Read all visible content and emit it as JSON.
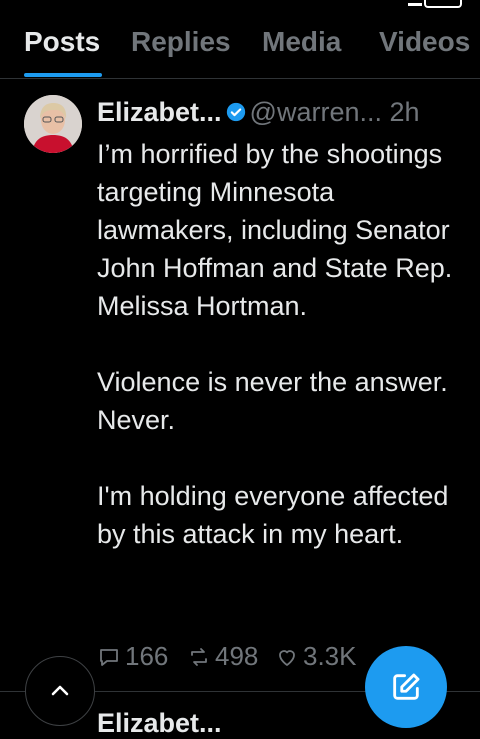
{
  "tabs": [
    "Posts",
    "Replies",
    "Media",
    "Videos"
  ],
  "post": {
    "display_name": "Elizabet...",
    "handle": "@warren...",
    "time": "2h",
    "paragraphs": [
      "I’m horrified by the shootings targeting Minnesota lawmakers, including Senator John Hoffman and State Rep. Melissa Hortman.",
      "Violence is never the answer. Never.",
      "I'm holding everyone affected by this attack in my heart."
    ],
    "replies": "166",
    "reposts": "498",
    "likes": "3.3K"
  },
  "next_post": {
    "display_name": "Elizabet..."
  },
  "colors": {
    "accent": "#1d9bf0",
    "text": "#e7e9ea",
    "muted": "#71767b",
    "background": "#000000"
  },
  "icons": [
    "reply-icon",
    "repost-icon",
    "like-icon",
    "verified-badge-icon",
    "chevron-up-icon",
    "compose-icon"
  ]
}
